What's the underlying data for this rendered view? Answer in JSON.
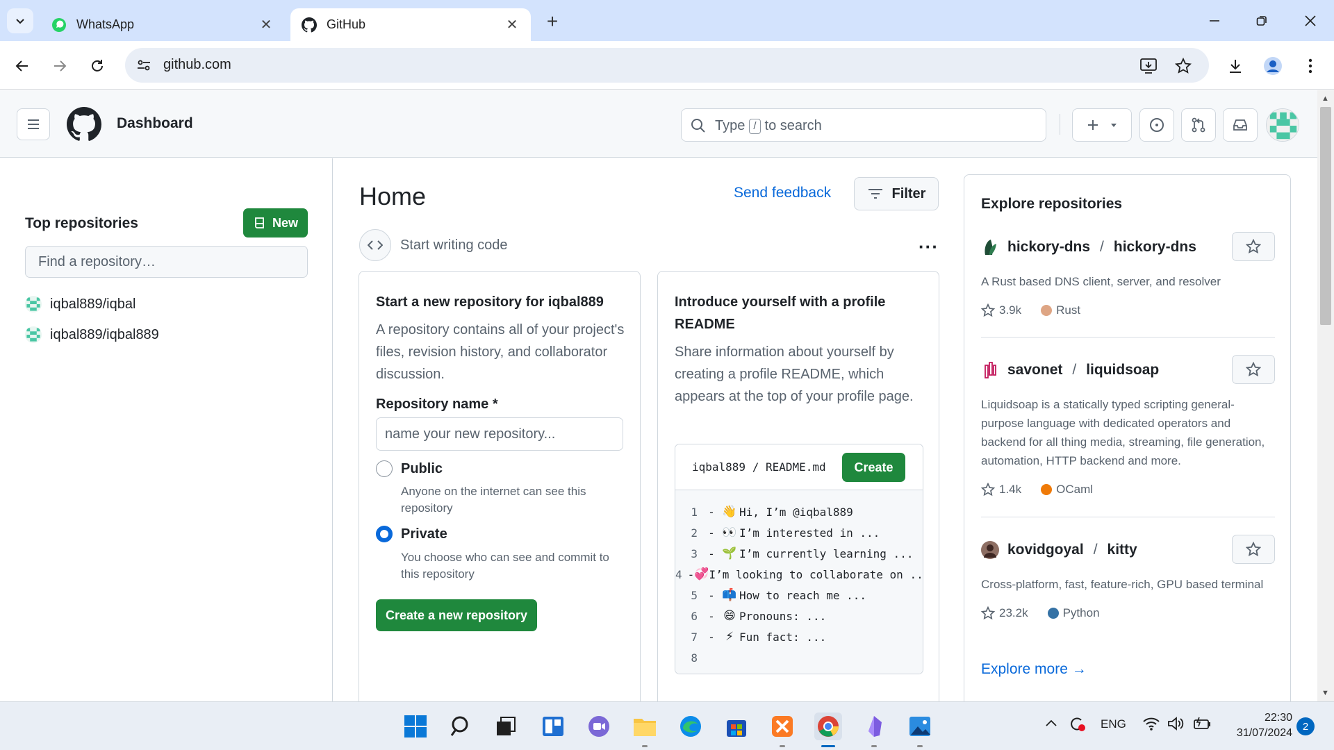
{
  "browser": {
    "tabs": [
      {
        "title": "WhatsApp",
        "favicon": "whatsapp-icon",
        "active": false
      },
      {
        "title": "GitHub",
        "favicon": "github-icon",
        "active": true
      }
    ],
    "url": "github.com"
  },
  "header": {
    "context": "Dashboard",
    "search_text_before": "Type",
    "search_key": "/",
    "search_text_after": "to search"
  },
  "sidebar": {
    "title": "Top repositories",
    "new_label": "New",
    "find_placeholder": "Find a repository…",
    "repos": [
      {
        "name": "iqbal889/iqbal"
      },
      {
        "name": "iqbal889/iqbal889"
      }
    ]
  },
  "main": {
    "title": "Home",
    "send_feedback": "Send feedback",
    "filter_label": "Filter",
    "start_writing": "Start writing code",
    "new_repo_card": {
      "title": "Start a new repository for iqbal889",
      "description": "A repository contains all of your project's files, revision history, and collaborator discussion.",
      "name_label": "Repository name *",
      "name_placeholder": "name your new repository...",
      "public_label": "Public",
      "public_desc": "Anyone on the internet can see this repository",
      "private_label": "Private",
      "private_desc": "You choose who can see and commit to this repository",
      "visibility_selected": "Private",
      "create_button": "Create a new repository"
    },
    "readme_card": {
      "title": "Introduce yourself with a profile README",
      "description": "Share information about yourself by creating a profile README, which appears at the top of your profile page.",
      "path_user": "iqbal889",
      "path_file": "README.md",
      "create_button": "Create",
      "lines": [
        {
          "n": "1",
          "emoji": "👋",
          "text": "Hi, I’m @iqbal889"
        },
        {
          "n": "2",
          "emoji": "👀",
          "text": "I’m interested in ..."
        },
        {
          "n": "3",
          "emoji": "🌱",
          "text": "I’m currently learning ..."
        },
        {
          "n": "4",
          "emoji": "💞️",
          "text": "I’m looking to collaborate on ..."
        },
        {
          "n": "5",
          "emoji": "📫",
          "text": "How to reach me ..."
        },
        {
          "n": "6",
          "emoji": "😄",
          "text": "Pronouns: ..."
        },
        {
          "n": "7",
          "emoji": "⚡",
          "text": "Fun fact: ..."
        },
        {
          "n": "8",
          "emoji": "",
          "text": ""
        }
      ]
    }
  },
  "explore": {
    "title": "Explore repositories",
    "repos": [
      {
        "owner": "hickory-dns",
        "name": "hickory-dns",
        "description": "A Rust based DNS client, server, and resolver",
        "stars": "3.9k",
        "language": "Rust",
        "lang_color": "#dea584"
      },
      {
        "owner": "savonet",
        "name": "liquidsoap",
        "description": "Liquidsoap is a statically typed scripting general-purpose language with dedicated operators and backend for all thing media, streaming, file generation, automation, HTTP backend and more.",
        "stars": "1.4k",
        "language": "OCaml",
        "lang_color": "#ef7a08"
      },
      {
        "owner": "kovidgoyal",
        "name": "kitty",
        "description": "Cross-platform, fast, feature-rich, GPU based terminal",
        "stars": "23.2k",
        "language": "Python",
        "lang_color": "#3572A5"
      }
    ],
    "more_label": "Explore more →"
  },
  "taskbar": {
    "lang": "ENG",
    "time": "22:30",
    "date": "31/07/2024",
    "notifications": "2"
  }
}
